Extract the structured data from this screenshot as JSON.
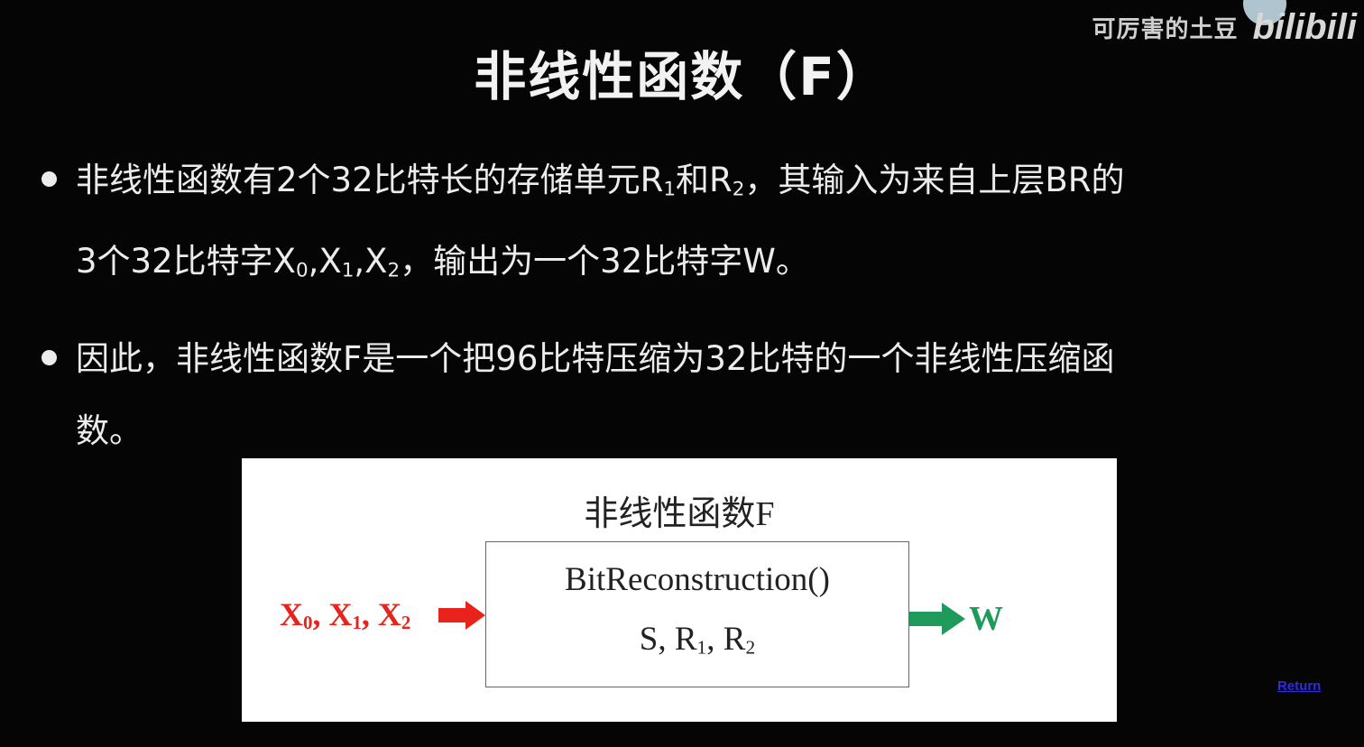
{
  "watermark": {
    "channel_name": "可厉害的土豆",
    "logo_text": "bilibili"
  },
  "slide": {
    "title": "非线性函数（F）",
    "bullets": [
      {
        "line1_a": "非线性函数有2个32比特长的存储单元R",
        "line1_sub1": "1",
        "line1_b": "和R",
        "line1_sub2": "2",
        "line1_c": "，其输入为来自上层BR的",
        "line2_a": "3个32比特字X",
        "line2_sub0": "0",
        "line2_b": ",X",
        "line2_sub1": "1",
        "line2_c": ",X",
        "line2_sub2": "2",
        "line2_d": "，输出为一个32比特字W。"
      },
      {
        "line1": "因此，非线性函数F是一个把96比特压缩为32比特的一个非线性压缩函",
        "line2": "数。"
      }
    ],
    "figure": {
      "title": "非线性函数F",
      "box_line1": "BitReconstruction()",
      "box_line2_a": "S, R",
      "box_line2_sub1": "1",
      "box_line2_b": ", R",
      "box_line2_sub2": "2",
      "input_label": {
        "x0": "X",
        "s0": "0",
        "x1": ", X",
        "s1": "1",
        "x2": ", X",
        "s2": "2"
      },
      "output_label": "W",
      "input_color": "#e8231b",
      "output_color": "#1f9a5a"
    },
    "return_link": "Return"
  }
}
